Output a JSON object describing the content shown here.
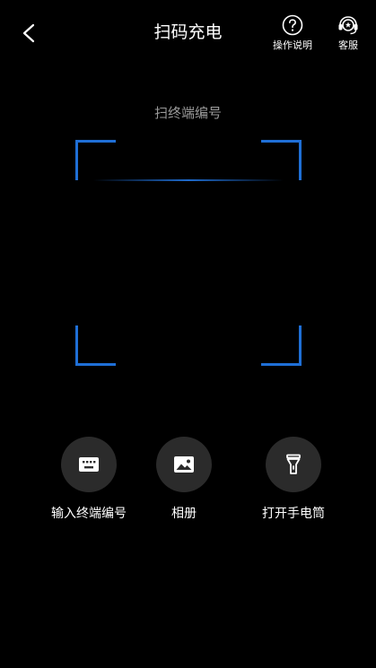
{
  "header": {
    "title": "扫码充电",
    "help_label": "操作说明",
    "service_label": "客服"
  },
  "scan": {
    "hint": "扫终端编号"
  },
  "actions": {
    "input_label": "输入终端编号",
    "album_label": "相册",
    "torch_label": "打开手电筒"
  },
  "colors": {
    "background": "#000000",
    "accent": "#1f6fd6",
    "hint_text": "#9a9a9a",
    "button_bg": "#2b2b2b"
  },
  "icons": {
    "back": "chevron-left-icon",
    "help": "question-circle-icon",
    "service": "headset-icon",
    "input": "keyboard-icon",
    "album": "image-icon",
    "torch": "flashlight-icon"
  }
}
